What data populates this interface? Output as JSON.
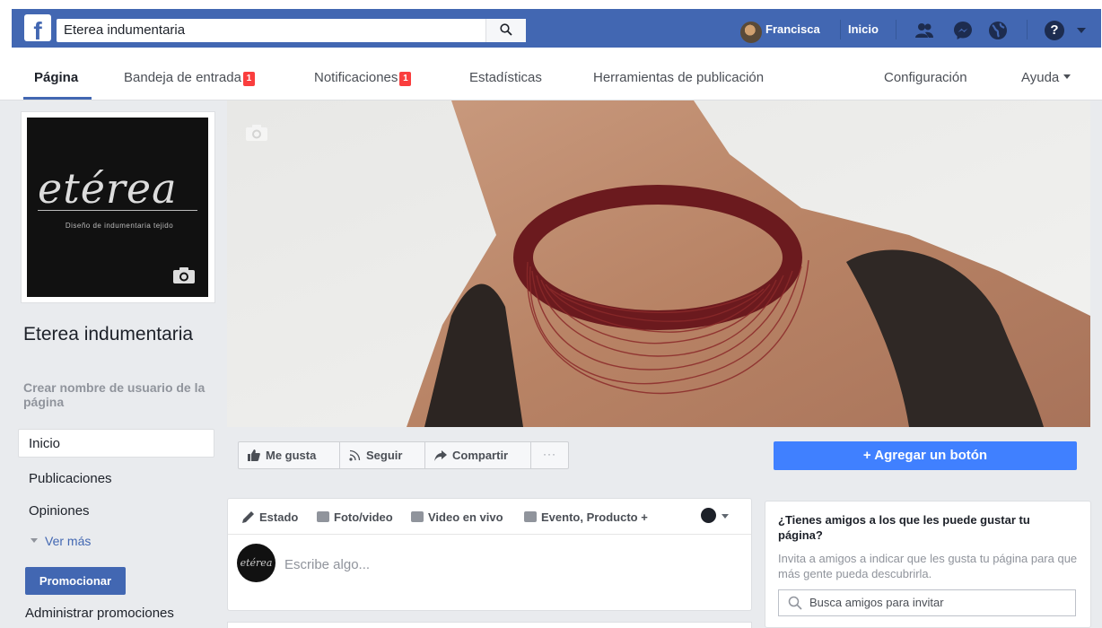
{
  "topbar": {
    "logo": "f",
    "search_value": "Eterea indumentaria",
    "user_name": "Francisca",
    "home": "Inicio",
    "help": "?",
    "icons": [
      "friends-icon",
      "messenger-icon",
      "globe-icon",
      "help-icon"
    ]
  },
  "nav": {
    "tabs": [
      {
        "label": "Página"
      },
      {
        "label": "Bandeja de entrada",
        "badge": "1"
      },
      {
        "label": "Notificaciones",
        "badge": "1"
      },
      {
        "label": "Estadísticas"
      },
      {
        "label": "Herramientas de publicación"
      },
      {
        "label": "Configuración"
      },
      {
        "label": "Ayuda"
      }
    ]
  },
  "profile": {
    "logo_script": "etérea",
    "logo_tagline": "Diseño de indumentaria tejido",
    "page_name": "Eterea indumentaria",
    "username_prompt": "Crear nombre de usuario de la página"
  },
  "sidebar": {
    "items": [
      "Inicio",
      "Publicaciones",
      "Opiniones"
    ],
    "see_more": "Ver más",
    "promote": "Promocionar",
    "manage_promotions": "Administrar promociones"
  },
  "actions": {
    "like": "Me gusta",
    "follow": "Seguir",
    "share": "Compartir",
    "more": "···",
    "add_button": "+ Agregar un botón"
  },
  "composer": {
    "tabs": [
      "Estado",
      "Foto/video",
      "Video en vivo",
      "Evento, Producto +"
    ],
    "placeholder": "Escribe algo...",
    "avatar_text": "etérea"
  },
  "invite": {
    "title": "¿Tienes amigos a los que les puede gustar tu página?",
    "subtitle": "Invita a amigos a indicar que les gusta tu página para que más gente pueda descubrirla.",
    "search_placeholder": "Busca amigos para invitar"
  },
  "colors": {
    "brand": "#4267b2",
    "accent_button": "#4080ff",
    "badge": "#fa3e3e"
  }
}
